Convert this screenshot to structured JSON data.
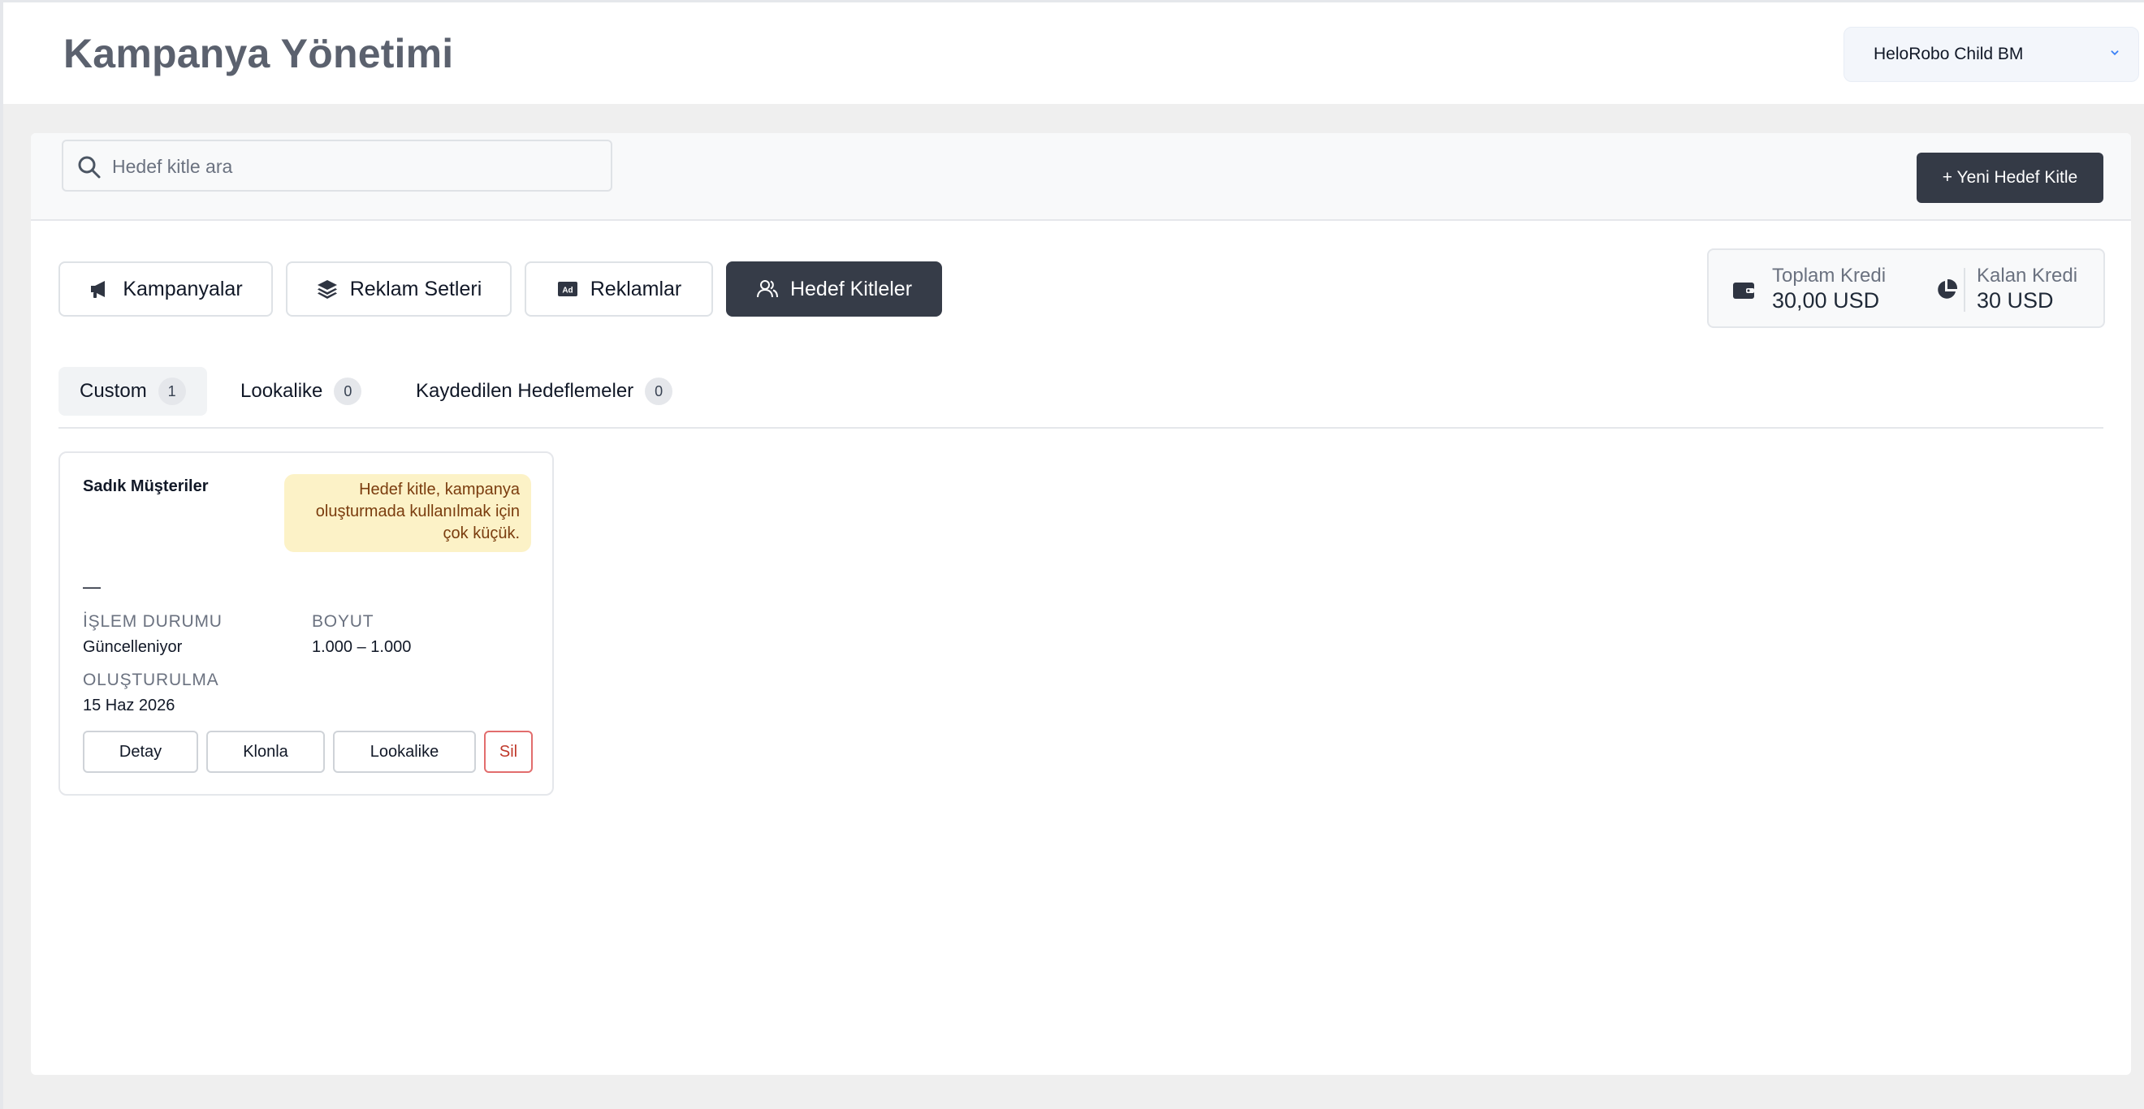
{
  "header": {
    "title": "Kampanya Yönetimi",
    "business_manager": "HeloRobo Child BM"
  },
  "search": {
    "placeholder": "Hedef kitle ara",
    "value": ""
  },
  "actions": {
    "new_audience": "+ Yeni Hedef Kitle"
  },
  "nav": {
    "items": [
      {
        "label": "Kampanyalar",
        "icon": "megaphone-icon",
        "active": false
      },
      {
        "label": "Reklam Setleri",
        "icon": "layers-icon",
        "active": false
      },
      {
        "label": "Reklamlar",
        "icon": "ad-icon",
        "active": false
      },
      {
        "label": "Hedef Kitleler",
        "icon": "users-icon",
        "active": true
      }
    ]
  },
  "credits": {
    "total_label": "Toplam Kredi",
    "total_value": "30,00 USD",
    "remaining_label": "Kalan Kredi",
    "remaining_value": "30 USD"
  },
  "subtabs": [
    {
      "label": "Custom",
      "count": "1",
      "active": true
    },
    {
      "label": "Lookalike",
      "count": "0",
      "active": false
    },
    {
      "label": "Kaydedilen Hedeflemeler",
      "count": "0",
      "active": false
    }
  ],
  "audience_card": {
    "name": "Sadık Müşteriler",
    "warning": "Hedef kitle, kampanya oluşturmada kullanılmak için çok küçük.",
    "description": "—",
    "status_label": "İŞLEM DURUMU",
    "status_value": "Güncelleniyor",
    "size_label": "BOYUT",
    "size_value": "1.000 – 1.000",
    "created_label": "OLUŞTURULMA",
    "created_value": "15 Haz 2026",
    "buttons": {
      "detail": "Detay",
      "clone": "Klonla",
      "lookalike": "Lookalike",
      "delete": "Sil"
    }
  },
  "colors": {
    "active_dark": "#363c48",
    "warning_bg": "#fcf2c7",
    "warning_text": "#7a3c0e",
    "danger": "#c0392b"
  }
}
